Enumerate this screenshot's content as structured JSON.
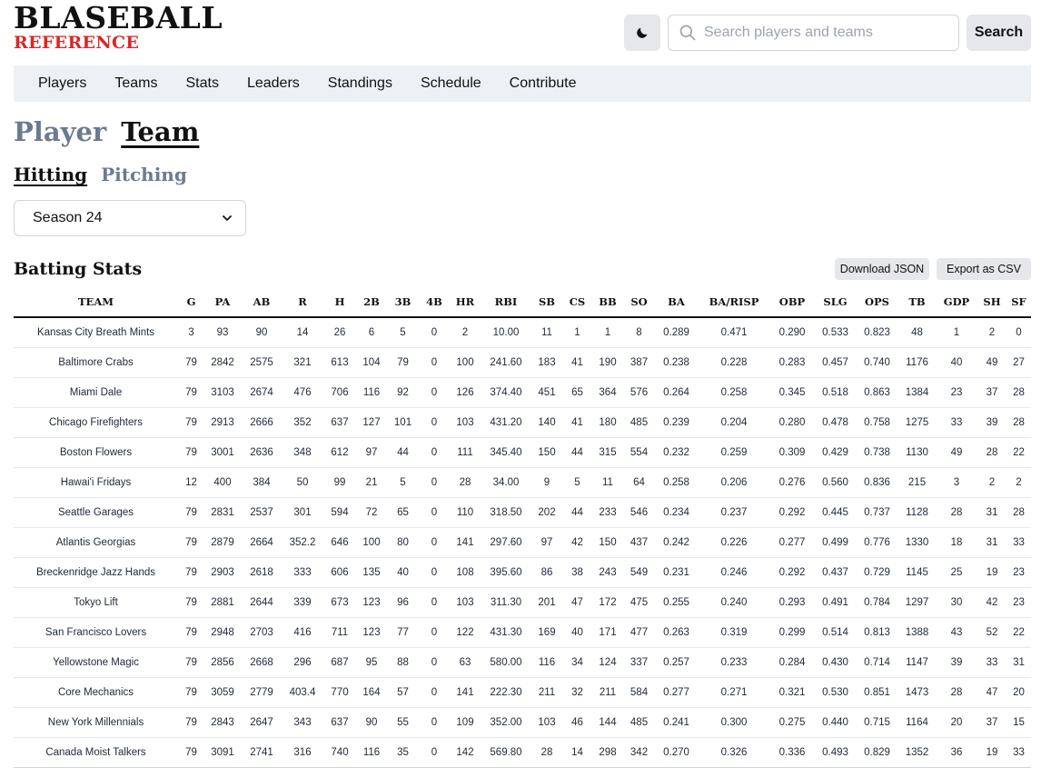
{
  "logo": {
    "top": "BLASEBALL",
    "bottom": "REFERENCE"
  },
  "header": {
    "search_placeholder": "Search players and teams",
    "search_button": "Search"
  },
  "nav": [
    "Players",
    "Teams",
    "Stats",
    "Leaders",
    "Standings",
    "Schedule",
    "Contribute"
  ],
  "main_tabs": {
    "player": "Player",
    "team": "Team",
    "active": "Team"
  },
  "sub_tabs": {
    "hitting": "Hitting",
    "pitching": "Pitching",
    "active": "Hitting"
  },
  "season_select": {
    "value": "Season 24"
  },
  "section": {
    "title": "Batting Stats",
    "download_json": "Download JSON",
    "export_csv": "Export as CSV"
  },
  "table": {
    "columns": [
      "TEAM",
      "G",
      "PA",
      "AB",
      "R",
      "H",
      "2B",
      "3B",
      "4B",
      "HR",
      "RBI",
      "SB",
      "CS",
      "BB",
      "SO",
      "BA",
      "BA/RISP",
      "OBP",
      "SLG",
      "OPS",
      "TB",
      "GDP",
      "SH",
      "SF"
    ],
    "rows": [
      [
        "Kansas City Breath Mints",
        "3",
        "93",
        "90",
        "14",
        "26",
        "6",
        "5",
        "0",
        "2",
        "10.00",
        "11",
        "1",
        "1",
        "8",
        "0.289",
        "0.471",
        "0.290",
        "0.533",
        "0.823",
        "48",
        "1",
        "2",
        "0"
      ],
      [
        "Baltimore Crabs",
        "79",
        "2842",
        "2575",
        "321",
        "613",
        "104",
        "79",
        "0",
        "100",
        "241.60",
        "183",
        "41",
        "190",
        "387",
        "0.238",
        "0.228",
        "0.283",
        "0.457",
        "0.740",
        "1176",
        "40",
        "49",
        "27"
      ],
      [
        "Miami Dale",
        "79",
        "3103",
        "2674",
        "476",
        "706",
        "116",
        "92",
        "0",
        "126",
        "374.40",
        "451",
        "65",
        "364",
        "576",
        "0.264",
        "0.258",
        "0.345",
        "0.518",
        "0.863",
        "1384",
        "23",
        "37",
        "28"
      ],
      [
        "Chicago Firefighters",
        "79",
        "2913",
        "2666",
        "352",
        "637",
        "127",
        "101",
        "0",
        "103",
        "431.20",
        "140",
        "41",
        "180",
        "485",
        "0.239",
        "0.204",
        "0.280",
        "0.478",
        "0.758",
        "1275",
        "33",
        "39",
        "28"
      ],
      [
        "Boston Flowers",
        "79",
        "3001",
        "2636",
        "348",
        "612",
        "97",
        "44",
        "0",
        "111",
        "345.40",
        "150",
        "44",
        "315",
        "554",
        "0.232",
        "0.259",
        "0.309",
        "0.429",
        "0.738",
        "1130",
        "49",
        "28",
        "22"
      ],
      [
        "Hawai'i Fridays",
        "12",
        "400",
        "384",
        "50",
        "99",
        "21",
        "5",
        "0",
        "28",
        "34.00",
        "9",
        "5",
        "11",
        "64",
        "0.258",
        "0.206",
        "0.276",
        "0.560",
        "0.836",
        "215",
        "3",
        "2",
        "2"
      ],
      [
        "Seattle Garages",
        "79",
        "2831",
        "2537",
        "301",
        "594",
        "72",
        "65",
        "0",
        "110",
        "318.50",
        "202",
        "44",
        "233",
        "546",
        "0.234",
        "0.237",
        "0.292",
        "0.445",
        "0.737",
        "1128",
        "28",
        "31",
        "28"
      ],
      [
        "Atlantis Georgias",
        "79",
        "2879",
        "2664",
        "352.2",
        "646",
        "100",
        "80",
        "0",
        "141",
        "297.60",
        "97",
        "42",
        "150",
        "437",
        "0.242",
        "0.226",
        "0.277",
        "0.499",
        "0.776",
        "1330",
        "18",
        "31",
        "33"
      ],
      [
        "Breckenridge Jazz Hands",
        "79",
        "2903",
        "2618",
        "333",
        "606",
        "135",
        "40",
        "0",
        "108",
        "395.60",
        "86",
        "38",
        "243",
        "549",
        "0.231",
        "0.246",
        "0.292",
        "0.437",
        "0.729",
        "1145",
        "25",
        "19",
        "23"
      ],
      [
        "Tokyo Lift",
        "79",
        "2881",
        "2644",
        "339",
        "673",
        "123",
        "96",
        "0",
        "103",
        "311.30",
        "201",
        "47",
        "172",
        "475",
        "0.255",
        "0.240",
        "0.293",
        "0.491",
        "0.784",
        "1297",
        "30",
        "42",
        "23"
      ],
      [
        "San Francisco Lovers",
        "79",
        "2948",
        "2703",
        "416",
        "711",
        "123",
        "77",
        "0",
        "122",
        "431.30",
        "169",
        "40",
        "171",
        "477",
        "0.263",
        "0.319",
        "0.299",
        "0.514",
        "0.813",
        "1388",
        "43",
        "52",
        "22"
      ],
      [
        "Yellowstone Magic",
        "79",
        "2856",
        "2668",
        "296",
        "687",
        "95",
        "88",
        "0",
        "63",
        "580.00",
        "116",
        "34",
        "124",
        "337",
        "0.257",
        "0.233",
        "0.284",
        "0.430",
        "0.714",
        "1147",
        "39",
        "33",
        "31"
      ],
      [
        "Core Mechanics",
        "79",
        "3059",
        "2779",
        "403.4",
        "770",
        "164",
        "57",
        "0",
        "141",
        "222.30",
        "211",
        "32",
        "211",
        "584",
        "0.277",
        "0.271",
        "0.321",
        "0.530",
        "0.851",
        "1473",
        "28",
        "47",
        "20"
      ],
      [
        "New York Millennials",
        "79",
        "2843",
        "2647",
        "343",
        "637",
        "90",
        "55",
        "0",
        "109",
        "352.00",
        "103",
        "46",
        "144",
        "485",
        "0.241",
        "0.300",
        "0.275",
        "0.440",
        "0.715",
        "1164",
        "20",
        "37",
        "15"
      ],
      [
        "Canada Moist Talkers",
        "79",
        "3091",
        "2741",
        "316",
        "740",
        "116",
        "35",
        "0",
        "142",
        "569.80",
        "28",
        "14",
        "298",
        "342",
        "0.270",
        "0.326",
        "0.336",
        "0.493",
        "0.829",
        "1352",
        "36",
        "19",
        "33"
      ]
    ]
  }
}
